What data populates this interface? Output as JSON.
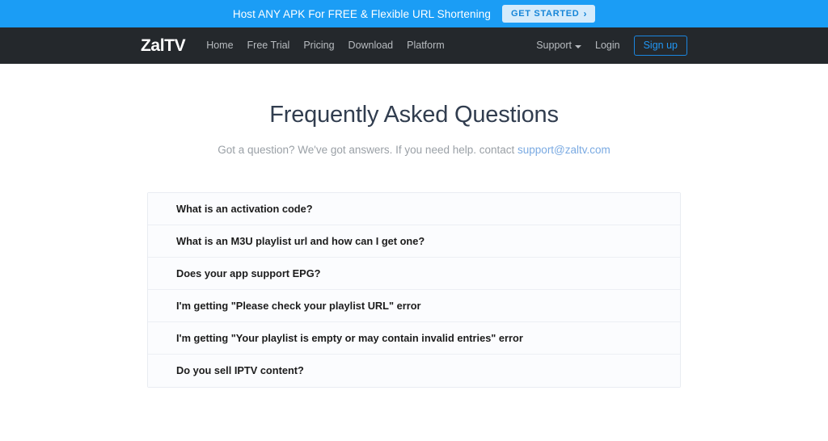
{
  "promo_banner": {
    "text": "Host ANY APK For FREE & Flexible URL Shortening",
    "cta_label": "GET STARTED",
    "cta_chevron": "›",
    "background_color": "#1b9df5",
    "cta_background_color": "#d5ebfb",
    "cta_text_color": "#1585d8"
  },
  "navbar": {
    "brand": "ZalTV",
    "background_color": "#24282c",
    "links": [
      {
        "label": "Home"
      },
      {
        "label": "Free Trial"
      },
      {
        "label": "Pricing"
      },
      {
        "label": "Download"
      },
      {
        "label": "Platform"
      }
    ],
    "support_dropdown": {
      "label": "Support",
      "icon": "chevron-down-icon"
    },
    "login_label": "Login",
    "signup_label": "Sign up",
    "accent_color": "#2196f3"
  },
  "main": {
    "title": "Frequently Asked Questions",
    "subtitle_prefix": "Got a question? We've got answers. If you need help. contact ",
    "subtitle_email": "support@zaltv.com",
    "faq_items": [
      {
        "question": "What is an activation code?"
      },
      {
        "question": "What is an M3U playlist url and how can I get one?"
      },
      {
        "question": "Does your app support EPG?"
      },
      {
        "question": "I'm getting \"Please check your playlist URL\" error"
      },
      {
        "question": "I'm getting \"Your playlist is empty or may contain invalid entries\" error"
      },
      {
        "question": "Do you sell IPTV content?"
      }
    ]
  }
}
